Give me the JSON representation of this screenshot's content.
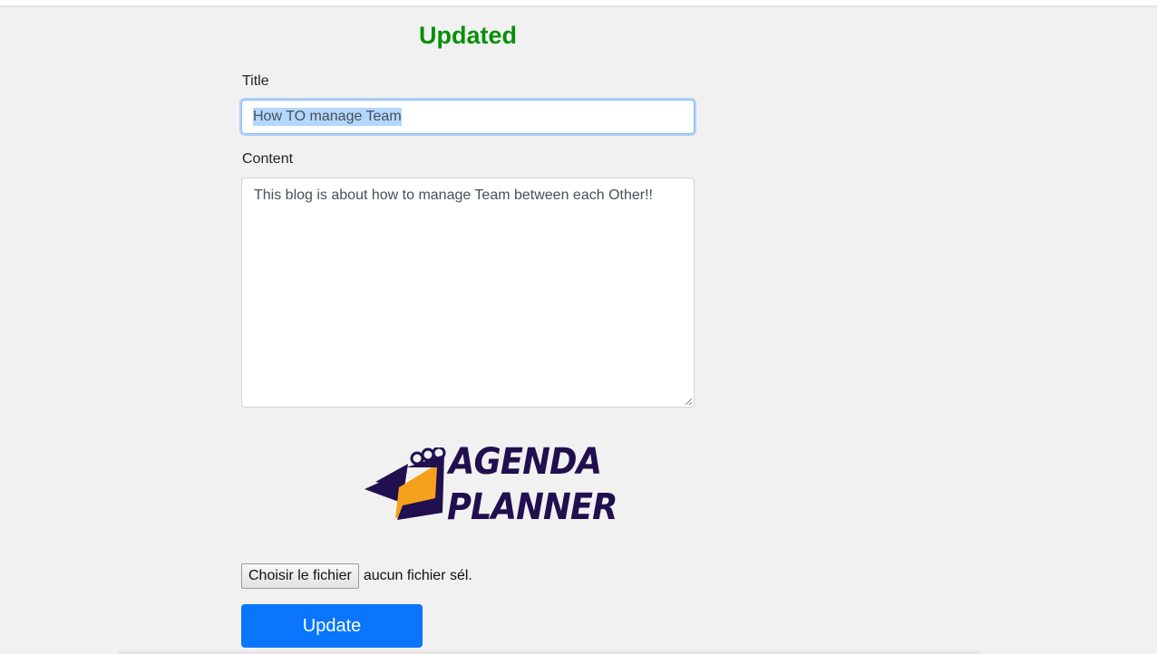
{
  "status": {
    "title": "Updated",
    "color": "#0a8f08"
  },
  "form": {
    "title_label": "Title",
    "title_value": "How TO manage Team",
    "content_label": "Content",
    "content_value": "This blog is about how to manage Team between each Other!!"
  },
  "logo": {
    "line1": "AGENDA",
    "line2": "PLANNER",
    "icon": "calendar-planner-icon"
  },
  "file_upload": {
    "button_label": "Choisir le fichier",
    "status_text": "aucun fichier sél."
  },
  "actions": {
    "update_label": "Update",
    "update_color": "#0a75fd"
  }
}
